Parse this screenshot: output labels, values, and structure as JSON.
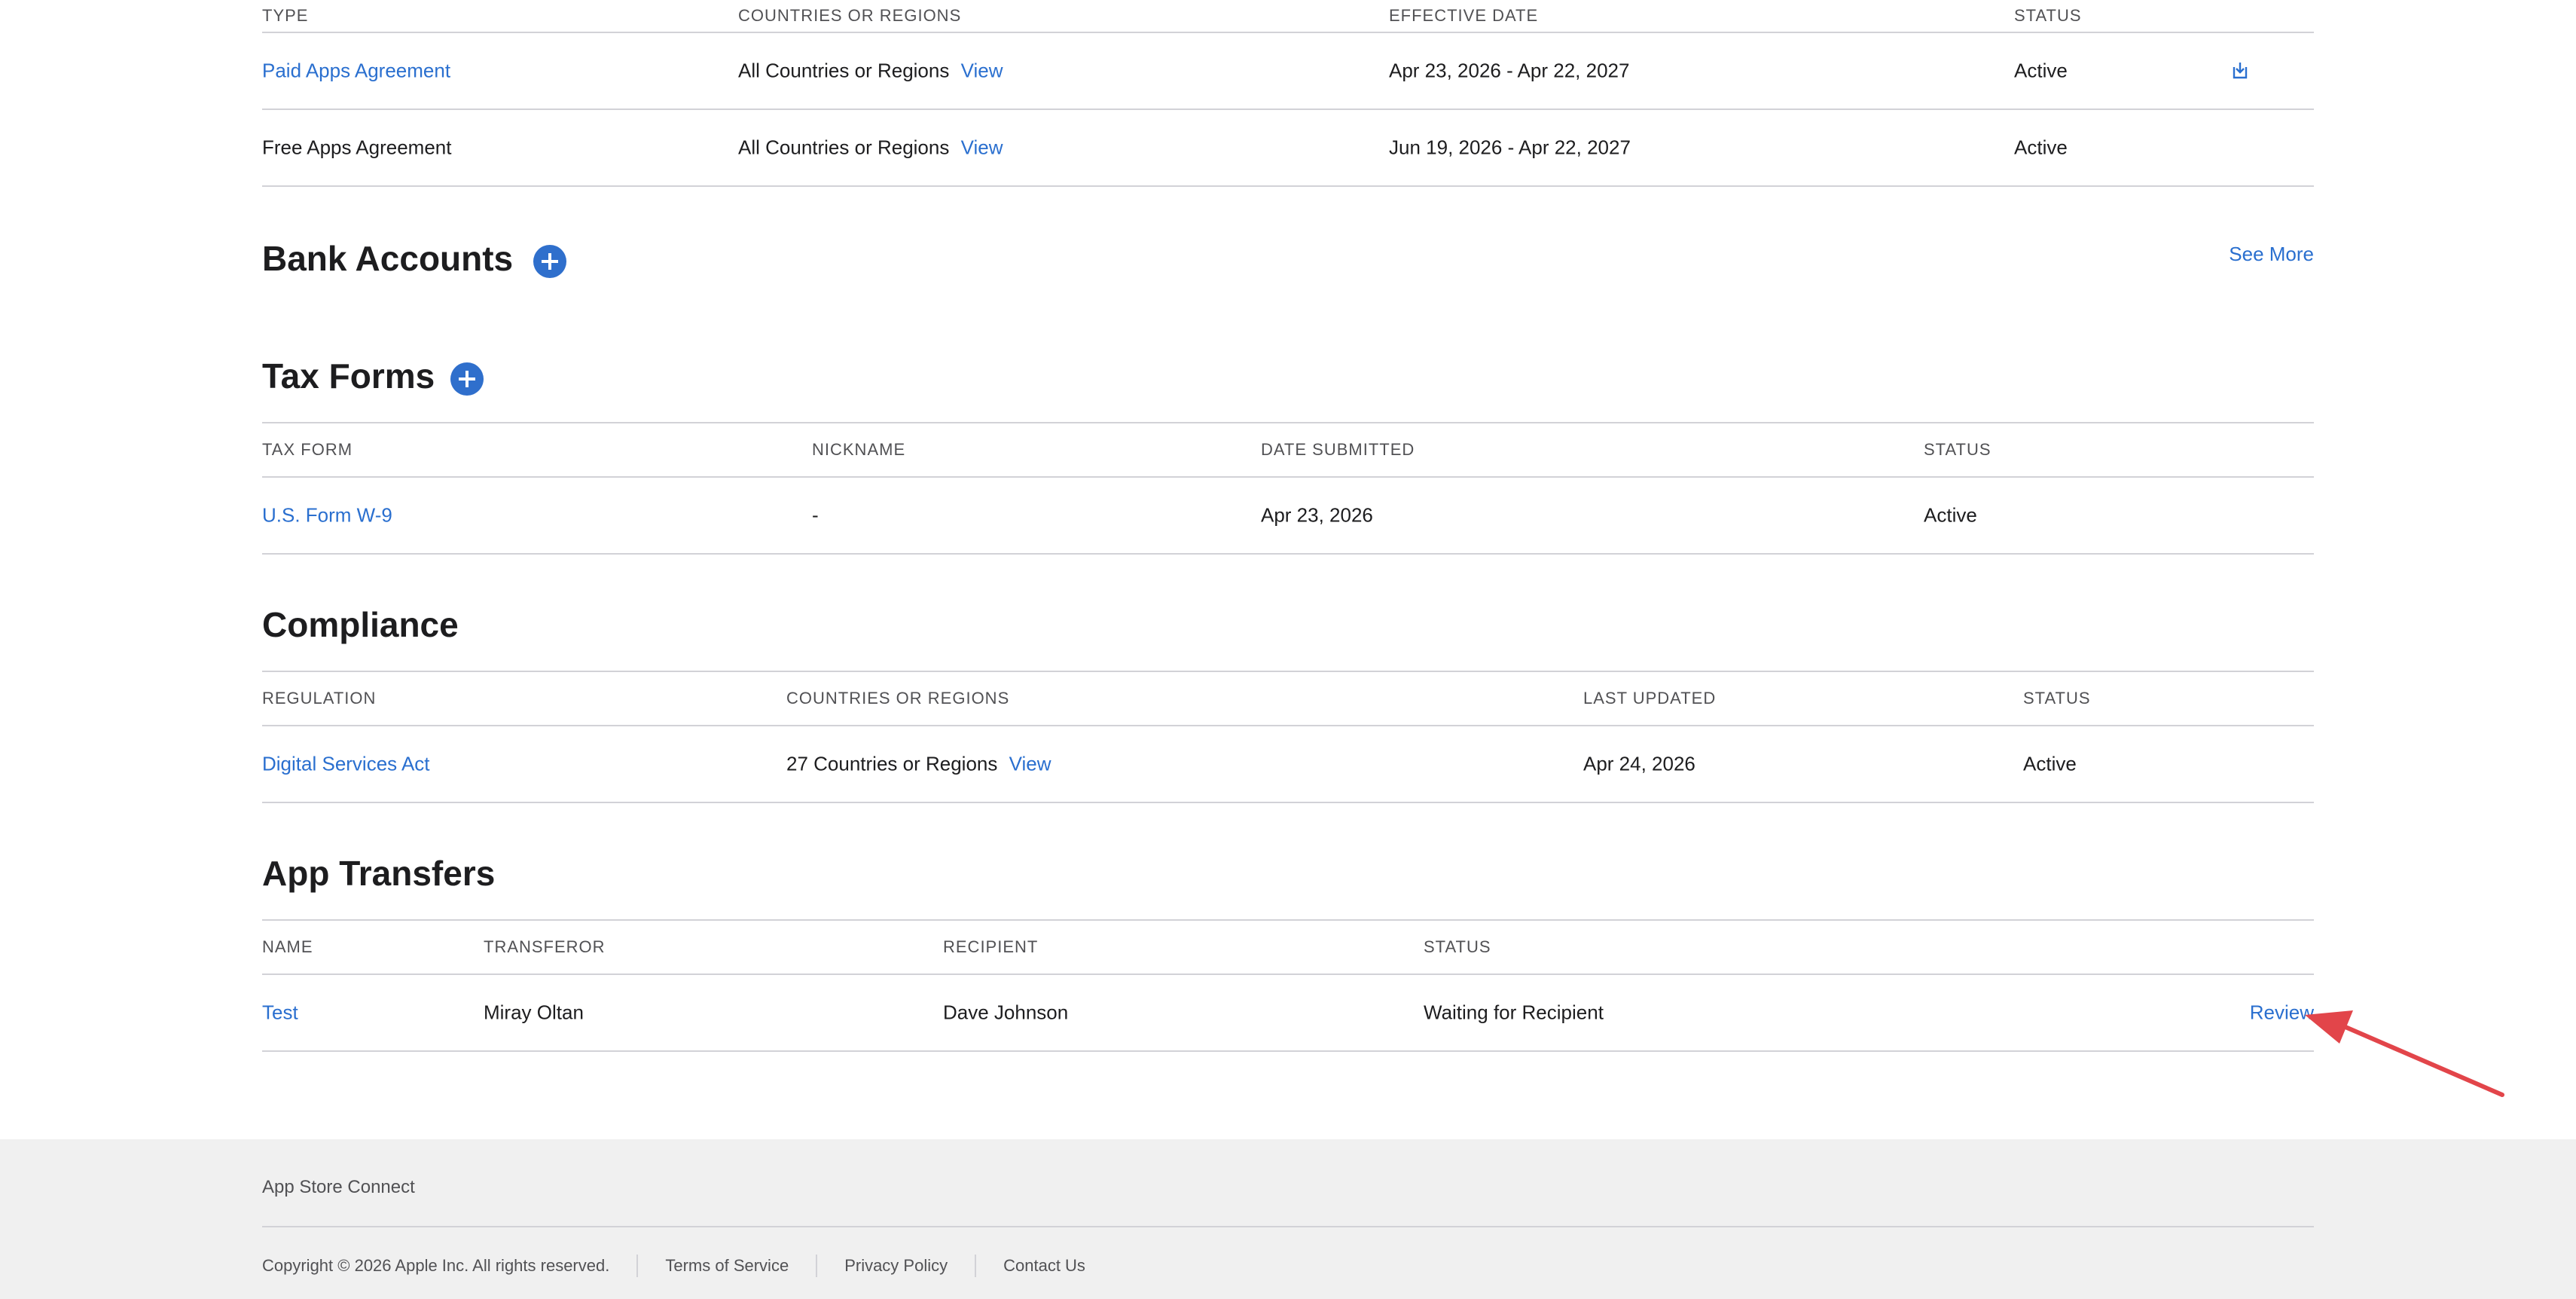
{
  "agreements": {
    "headers": {
      "type": "TYPE",
      "countries": "COUNTRIES OR REGIONS",
      "effective": "EFFECTIVE DATE",
      "status": "STATUS"
    },
    "rows": [
      {
        "type": "Paid Apps Agreement",
        "countries": "All Countries or Regions",
        "view": "View",
        "effective": "Apr 23, 2026 - Apr 22, 2027",
        "status": "Active",
        "icon": "download-icon"
      },
      {
        "type": "Free Apps Agreement",
        "countries": "All Countries or Regions",
        "view": "View",
        "effective": "Jun 19, 2026 - Apr 22, 2027",
        "status": "Active"
      }
    ]
  },
  "bank_accounts": {
    "title": "Bank Accounts",
    "see_more": "See More"
  },
  "tax_forms": {
    "title": "Tax Forms",
    "headers": {
      "form": "TAX FORM",
      "nickname": "NICKNAME",
      "date": "DATE SUBMITTED",
      "status": "STATUS"
    },
    "rows": [
      {
        "form": "U.S. Form W-9",
        "nickname": "-",
        "date": "Apr 23, 2026",
        "status": "Active"
      }
    ]
  },
  "compliance": {
    "title": "Compliance",
    "headers": {
      "regulation": "REGULATION",
      "countries": "COUNTRIES OR REGIONS",
      "updated": "LAST UPDATED",
      "status": "STATUS"
    },
    "rows": [
      {
        "regulation": "Digital Services Act",
        "countries": "27 Countries or Regions",
        "view": "View",
        "updated": "Apr 24, 2026",
        "status": "Active"
      }
    ]
  },
  "app_transfers": {
    "title": "App Transfers",
    "headers": {
      "name": "NAME",
      "transferor": "TRANSFEROR",
      "recipient": "RECIPIENT",
      "status": "STATUS"
    },
    "rows": [
      {
        "name": "Test",
        "transferor": "Miray Oltan",
        "recipient": "Dave Johnson",
        "status": "Waiting for Recipient",
        "action": "Review"
      }
    ]
  },
  "footer": {
    "title": "App Store Connect",
    "copyright": "Copyright © 2026 Apple Inc. All rights reserved.",
    "terms": "Terms of Service",
    "privacy": "Privacy Policy",
    "contact": "Contact Us"
  },
  "colors": {
    "link": "#2a6fcf",
    "add_button": "#2f6fcc",
    "annotation_arrow": "#e2454a",
    "footer_bg": "#f0f0f0"
  }
}
